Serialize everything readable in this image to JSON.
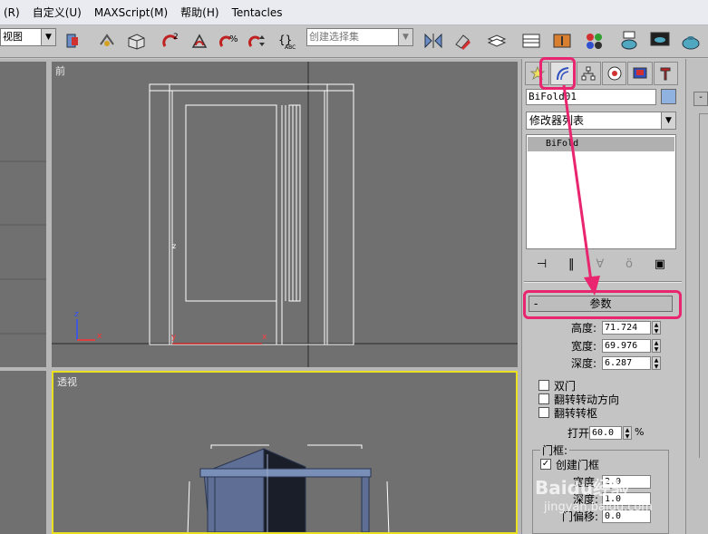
{
  "menu": {
    "items": [
      "(R)",
      "自定义(U)",
      "MAXScript(M)",
      "帮助(H)",
      "Tentacles"
    ]
  },
  "toolbar": {
    "view_select": "视图",
    "named_selection": "创建选择集",
    "angle_snap_label": "2",
    "percent_snap_label": "%",
    "icons": [
      "link-icon",
      "teapot-icon",
      "magnet-icon",
      "angle-snap-icon",
      "percent-snap-icon",
      "spinner-snap-icon",
      "edit-named-selection-icon",
      "mirror-icon",
      "align-icon",
      "layer-icon",
      "curve-editor-icon",
      "schematic-icon",
      "material-editor-icon",
      "render-setup-icon",
      "render-frame-icon",
      "quick-render-icon"
    ]
  },
  "viewports": {
    "front_label": "前",
    "perspective_label": "透视",
    "axis_z": "z",
    "axis_x": "x",
    "axis_y": "y"
  },
  "command_panel": {
    "tabs": [
      "create-tab",
      "modify-tab",
      "hierarchy-tab",
      "motion-tab",
      "display-tab",
      "utilities-tab"
    ],
    "object_name": "BiFold01",
    "swatch_color": "#8fb2e0",
    "modifier_list": "修改器列表",
    "stack_items": [
      "BiFold"
    ],
    "rollout_title": "参数",
    "rollout_minus": "-",
    "params": [
      {
        "label": "高度:",
        "value": "71.724"
      },
      {
        "label": "宽度:",
        "value": "69.976"
      },
      {
        "label": "深度:",
        "value": "6.287"
      }
    ],
    "checkboxes": [
      {
        "label": "双门",
        "checked": false
      },
      {
        "label": "翻转转动方向",
        "checked": false
      },
      {
        "label": "翻转转枢",
        "checked": false
      }
    ],
    "open_label": "打开:",
    "open_value": "60.0",
    "open_unit": "%",
    "frame_group": "门框:",
    "create_frame_label": "创建门框",
    "create_frame_mark": "✓",
    "frame_params": [
      {
        "label": "宽度:",
        "value": "2.0"
      },
      {
        "label": "深度:",
        "value": "1.0"
      },
      {
        "label": "门偏移:",
        "value": "0.0"
      }
    ]
  },
  "watermark": {
    "text": "Baidu经验",
    "url": "jingyan.baidu.com"
  },
  "colors": {
    "highlight": "#e8256e",
    "viewport_bg": "#707070",
    "active_border": "#e8e020"
  }
}
